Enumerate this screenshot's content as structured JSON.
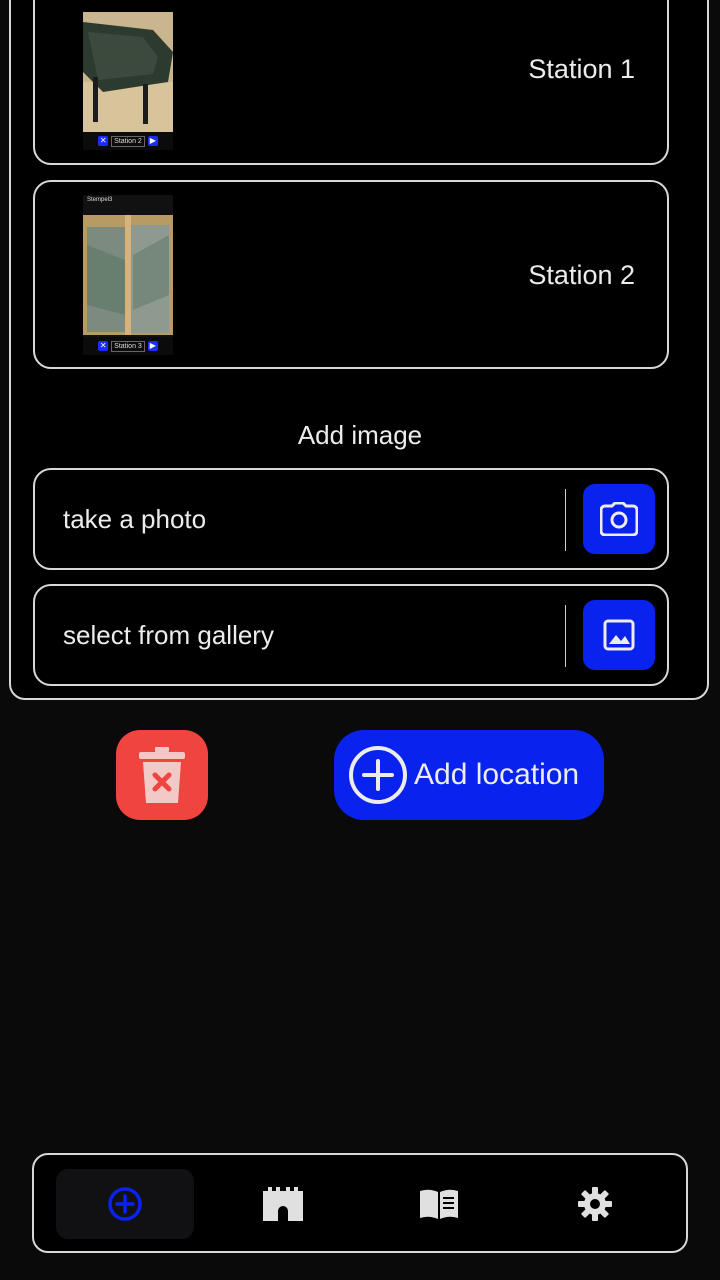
{
  "stations": [
    {
      "label": "Station 1",
      "thumb_tag": "Station 2"
    },
    {
      "label": "Station 2",
      "thumb_tag": "Station 3",
      "thumb_caption": "Stempel3"
    }
  ],
  "add_image": {
    "title": "Add image",
    "take_photo_label": "take a photo",
    "gallery_label": "select from gallery"
  },
  "actions": {
    "add_location_label": "Add location"
  },
  "icons": {
    "camera": "camera-icon",
    "gallery": "image-icon",
    "delete": "trash-icon",
    "add": "plus-circle-icon",
    "nav_add": "plus-circle-icon",
    "nav_castle": "castle-icon",
    "nav_book": "book-icon",
    "nav_settings": "gear-icon"
  },
  "colors": {
    "accent": "#0a22ee",
    "danger": "#f0443e",
    "background": "#0a0a0b",
    "panel": "#000000",
    "border": "#d8d8d8"
  }
}
